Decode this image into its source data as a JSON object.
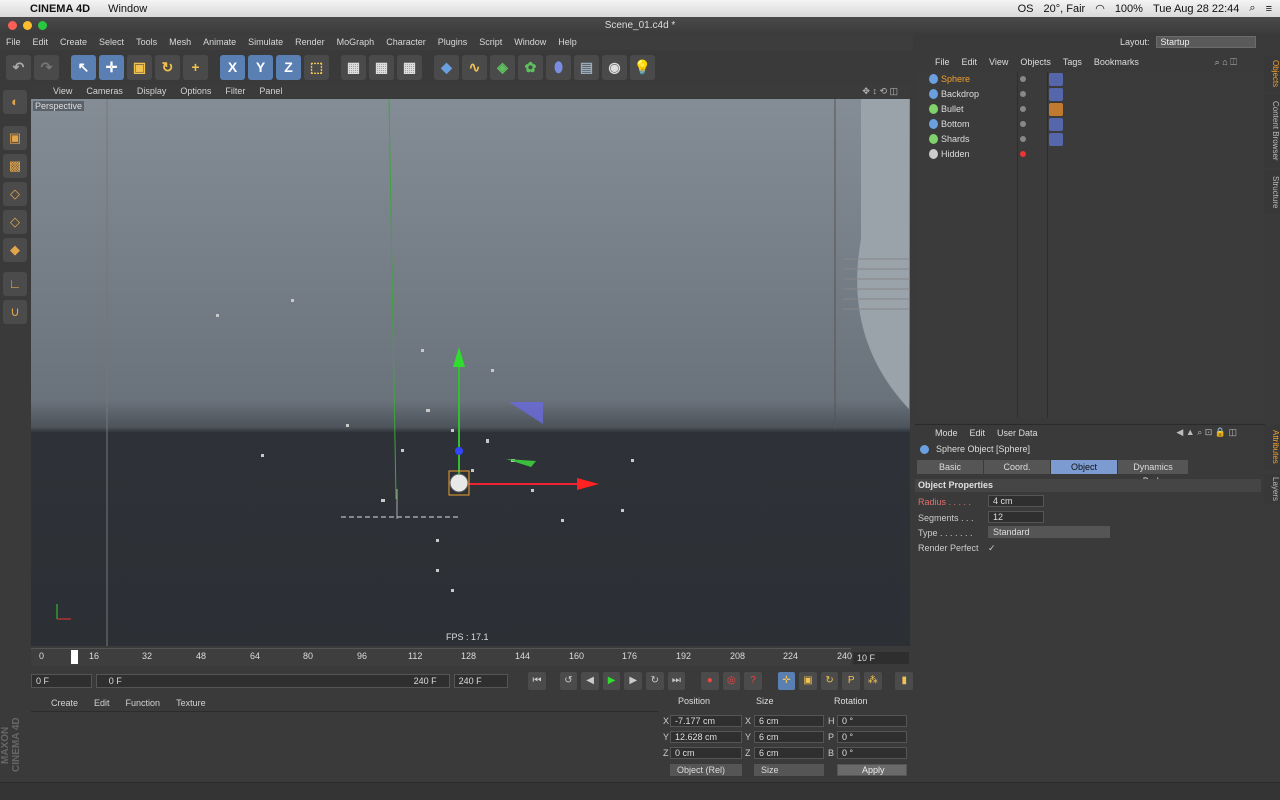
{
  "mac_menubar": {
    "app_name": "CINEMA 4D",
    "menu": "Window",
    "status_items": [
      "OS",
      "20°, Fair",
      "100%",
      "Tue Aug 28  22:44"
    ]
  },
  "window": {
    "title": "Scene_01.c4d *"
  },
  "main_menu": [
    "File",
    "Edit",
    "Create",
    "Select",
    "Tools",
    "Mesh",
    "Animate",
    "Simulate",
    "Render",
    "MoGraph",
    "Character",
    "Plugins",
    "Script",
    "Window",
    "Help"
  ],
  "layout": {
    "label": "Layout:",
    "value": "Startup"
  },
  "viewport": {
    "menu": [
      "View",
      "Cameras",
      "Display",
      "Options",
      "Filter",
      "Panel"
    ],
    "label": "Perspective",
    "fps": "FPS : 17.1"
  },
  "timeline": {
    "ticks": [
      "0",
      "16",
      "32",
      "48",
      "64",
      "80",
      "96",
      "112",
      "128",
      "144",
      "160",
      "176",
      "192",
      "208",
      "224",
      "240"
    ],
    "end_frame": "10 F",
    "current": "0 F",
    "range_start": "0 F",
    "range_end": "240 F",
    "max": "240 F"
  },
  "material_menu": [
    "Create",
    "Edit",
    "Function",
    "Texture"
  ],
  "coordinates": {
    "headers": [
      "Position",
      "Size",
      "Rotation"
    ],
    "rows": [
      {
        "axis": "X",
        "pos": "-7.177 cm",
        "size_axis": "X",
        "size": "6 cm",
        "rot_axis": "H",
        "rot": "0 °"
      },
      {
        "axis": "Y",
        "pos": "12.628 cm",
        "size_axis": "Y",
        "size": "6 cm",
        "rot_axis": "P",
        "rot": "0 °"
      },
      {
        "axis": "Z",
        "pos": "0 cm",
        "size_axis": "Z",
        "size": "6 cm",
        "rot_axis": "B",
        "rot": "0 °"
      }
    ],
    "mode": "Object (Rel)",
    "size_mode": "Size",
    "apply": "Apply"
  },
  "objects_menu": [
    "File",
    "Edit",
    "View",
    "Objects",
    "Tags",
    "Bookmarks"
  ],
  "objects": [
    {
      "name": "Sphere",
      "color": "#f0a030",
      "icon": "#6aa0e0"
    },
    {
      "name": "Backdrop",
      "color": "#dddddd",
      "icon": "#6aa0e0"
    },
    {
      "name": "Bullet",
      "color": "#dddddd",
      "icon": "#7fd36a"
    },
    {
      "name": "Bottom",
      "color": "#dddddd",
      "icon": "#6aa0e0"
    },
    {
      "name": "Shards",
      "color": "#dddddd",
      "icon": "#7fd36a"
    },
    {
      "name": "Hidden",
      "color": "#dddddd",
      "icon": "#cccccc"
    }
  ],
  "right_tabs": [
    "Objects",
    "Content Browser",
    "Structure",
    "Attributes",
    "Layers"
  ],
  "attributes": {
    "menu": [
      "Mode",
      "Edit",
      "User Data"
    ],
    "title": "Sphere Object [Sphere]",
    "tabs": [
      "Basic",
      "Coord.",
      "Object",
      "Dynamics Body"
    ],
    "active_tab": "Object",
    "section": "Object Properties",
    "props": [
      {
        "label": "Radius . . . . .",
        "value": "4 cm"
      },
      {
        "label": "Segments . . .",
        "value": "12"
      },
      {
        "label": "Type . . . . . . .",
        "value": "Standard"
      },
      {
        "label": "Render Perfect",
        "value": "✓"
      }
    ]
  },
  "brand": "MAXON CINEMA 4D"
}
